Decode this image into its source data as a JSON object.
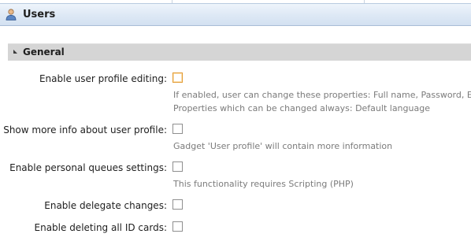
{
  "window": {
    "title": "Users",
    "icon": "user-icon"
  },
  "section": {
    "label": "General",
    "icon": "collapse-triangle-icon"
  },
  "settings": [
    {
      "label": "Enable user profile editing:",
      "checked": false,
      "focused": true,
      "hints": [
        "If enabled, user can change these properties: Full name, Password, Email",
        "Properties which can be changed always: Default language"
      ]
    },
    {
      "label": "Show more info about user profile:",
      "checked": false,
      "hints": [
        "Gadget 'User profile' will contain more information"
      ]
    },
    {
      "label": "Enable personal queues settings:",
      "checked": false,
      "hints": [
        "This functionality requires Scripting (PHP)"
      ]
    },
    {
      "label": "Enable delegate changes:",
      "checked": false,
      "hints": []
    },
    {
      "label": "Enable deleting all ID cards:",
      "checked": false,
      "hints": []
    }
  ],
  "colors": {
    "checkbox_focus": "#e39b33",
    "hint_text": "#7b7b7b",
    "section_bg": "#d5d5d5"
  }
}
